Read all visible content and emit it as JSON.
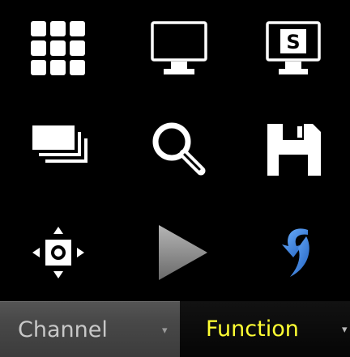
{
  "toolbar": {
    "icons": [
      {
        "name": "grid-layout-icon"
      },
      {
        "name": "single-monitor-icon"
      },
      {
        "name": "spot-monitor-icon",
        "glyph": "S"
      },
      {
        "name": "sequence-icon"
      },
      {
        "name": "search-icon"
      },
      {
        "name": "save-icon"
      },
      {
        "name": "ptz-control-icon"
      },
      {
        "name": "play-icon"
      },
      {
        "name": "return-icon"
      }
    ]
  },
  "tabs": [
    {
      "label": "Channel",
      "selected": false,
      "arrow": "▾"
    },
    {
      "label": "Function",
      "selected": true,
      "arrow": "▾"
    }
  ],
  "colors": {
    "background": "#000000",
    "icon": "#ffffff",
    "play_icon": "#9a9a9a",
    "return_icon": "#3a7fd9",
    "selected_tab_text": "#ffff33",
    "tab_text": "#c8c8c8"
  }
}
